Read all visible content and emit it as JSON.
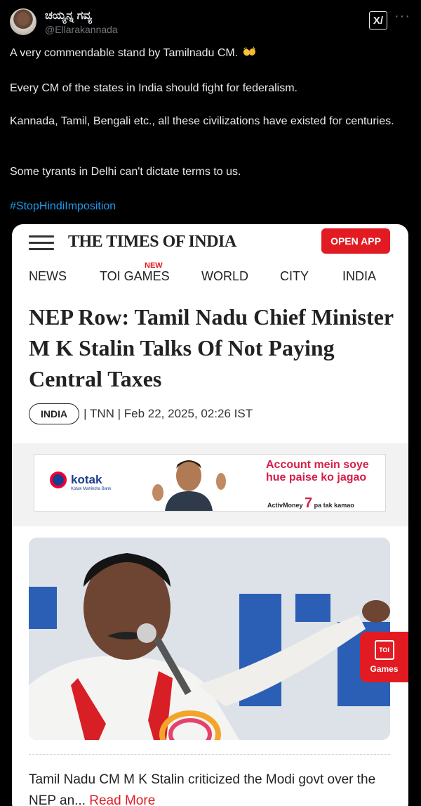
{
  "tweet": {
    "display_name": "ಚಯ್ಯನ್ನ ಗವ್ಯ",
    "handle": "@Ellarakannada",
    "grok_label": "X/",
    "more_label": "···",
    "line1": "A very commendable stand by Tamilnadu CM.",
    "line2": "Every CM of the states in India should fight for federalism.",
    "line3": "Kannada, Tamil, Bengali etc., all these civilizations have existed for centuries.",
    "line4": "Some tyrants in Delhi can't dictate terms to us.",
    "hashtag": "#StopHindiImposition",
    "emoji": "clapping-hands"
  },
  "card": {
    "brand": "THE TIMES OF INDIA",
    "open_app": "OPEN APP",
    "nav": {
      "news": "NEWS",
      "toi_games": "TOI GAMES",
      "new_badge": "NEW",
      "world": "WORLD",
      "city": "CITY",
      "india": "INDIA"
    },
    "headline": "NEP Row: Tamil Nadu Chief Minister M K Stalin Talks Of Not Paying Central Taxes",
    "tag": "INDIA",
    "meta": "| TNN | Feb 22, 2025, 02:26 IST",
    "ad": {
      "brand": "kotak",
      "brand_sub": "Kotak Mahindra Bank",
      "line1": "Account mein soye",
      "line2": "hue paise ko jagao",
      "small": "ActivMoney",
      "small_tail": "pa tak kamao",
      "number": "7"
    },
    "games": {
      "icon": "TOI",
      "label": "Games"
    },
    "summary": "Tamil Nadu CM M K Stalin criticized the Modi govt over the NEP an...",
    "read_more": "Read More"
  },
  "colors": {
    "background": "#000000",
    "text": "#e7e9ea",
    "muted": "#71767b",
    "link": "#1d9bf0",
    "toi_red": "#e21b22"
  }
}
